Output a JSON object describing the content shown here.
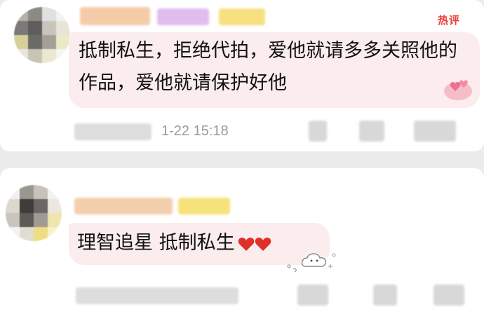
{
  "comment1": {
    "hot_label": "热评",
    "text": "抵制私生，拒绝代拍，爱他就请多多关照他的作品，爱他就请保护好他",
    "timestamp": "1-22 15:18"
  },
  "comment2": {
    "text": "理智追星 抵制私生",
    "emoji": "❤️❤️"
  },
  "colors": {
    "bubble": "#fbecee",
    "hot_label": "#e8413a",
    "timestamp": "#9a9a9a",
    "heart": "#e0302a"
  }
}
